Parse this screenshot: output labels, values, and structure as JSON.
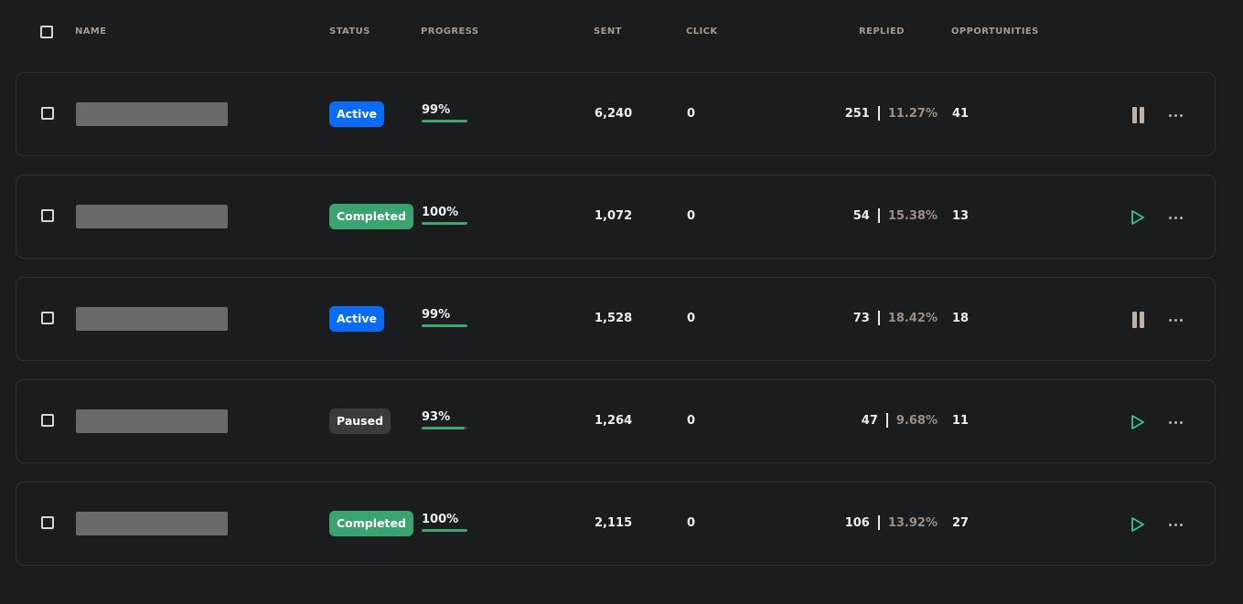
{
  "header": {
    "name": "NAME",
    "status": "STATUS",
    "progress": "PROGRESS",
    "sent": "SENT",
    "click": "CLICK",
    "replied": "REPLIED",
    "opportunities": "OPPORTUNITIES"
  },
  "colors": {
    "active": "#0a6cf5",
    "completed": "#39a46d",
    "paused": "#3a3b3e",
    "progress_fill": "#3fa56f",
    "play_icon": "#3cc09a",
    "pause_icon": "#bdb2a6"
  },
  "rows": [
    {
      "status": "Active",
      "status_kind": "active",
      "progress": "99%",
      "progress_pct": 99,
      "sent": "6,240",
      "click": "0",
      "replied_count": "251",
      "replied_rate": "11.27%",
      "opportunities": "41",
      "action_icon": "pause-icon"
    },
    {
      "status": "Completed",
      "status_kind": "completed",
      "progress": "100%",
      "progress_pct": 100,
      "sent": "1,072",
      "click": "0",
      "replied_count": "54",
      "replied_rate": "15.38%",
      "opportunities": "13",
      "action_icon": "play-icon"
    },
    {
      "status": "Active",
      "status_kind": "active",
      "progress": "99%",
      "progress_pct": 99,
      "sent": "1,528",
      "click": "0",
      "replied_count": "73",
      "replied_rate": "18.42%",
      "opportunities": "18",
      "action_icon": "pause-icon"
    },
    {
      "status": "Paused",
      "status_kind": "paused",
      "progress": "93%",
      "progress_pct": 93,
      "sent": "1,264",
      "click": "0",
      "replied_count": "47",
      "replied_rate": "9.68%",
      "opportunities": "11",
      "action_icon": "play-icon"
    },
    {
      "status": "Completed",
      "status_kind": "completed",
      "progress": "100%",
      "progress_pct": 100,
      "sent": "2,115",
      "click": "0",
      "replied_count": "106",
      "replied_rate": "13.92%",
      "opportunities": "27",
      "action_icon": "play-icon"
    }
  ]
}
